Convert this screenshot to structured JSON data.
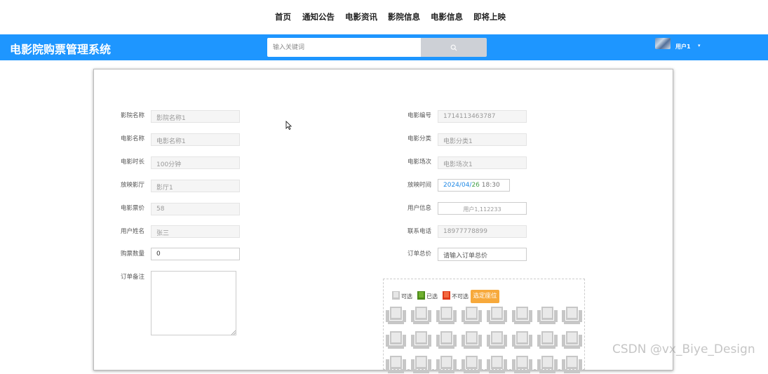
{
  "top_nav": [
    "首页",
    "通知公告",
    "电影资讯",
    "影院信息",
    "电影信息",
    "即将上映"
  ],
  "header": {
    "brand": "电影院购票管理系统",
    "search_placeholder": "输入关键词",
    "username": "用户1",
    "accent_color": "#1e96ff"
  },
  "form": {
    "left": [
      {
        "label": "影院名称",
        "value": "影院名称1"
      },
      {
        "label": "电影名称",
        "value": "电影名称1"
      },
      {
        "label": "电影时长",
        "value": "100分钟"
      },
      {
        "label": "放映影厅",
        "value": "影厅1"
      },
      {
        "label": "电影票价",
        "value": "58"
      },
      {
        "label": "用户姓名",
        "value": "张三"
      },
      {
        "label": "购票数量",
        "value": "0"
      }
    ],
    "right": [
      {
        "label": "电影编号",
        "value": "1714113463787"
      },
      {
        "label": "电影分类",
        "value": "电影分类1"
      },
      {
        "label": "电影场次",
        "value": "电影场次1"
      },
      {
        "label": "放映时间",
        "date_year": "2024",
        "date_month": "04",
        "date_day": "26",
        "time": "18:30"
      },
      {
        "label": "用户信息",
        "value": "用户1,112233"
      },
      {
        "label": "联系电话",
        "value": "18977778899"
      },
      {
        "label": "订单总价",
        "placeholder": "请输入订单总价"
      }
    ],
    "remark_label": "订单备注"
  },
  "seats": {
    "legend_available": "可选",
    "legend_selected": "已选",
    "legend_unavailable": "不可选",
    "pick_button": "选定座位",
    "colors": {
      "available": "#c7c7c7",
      "selected": "#4c8a1a",
      "unavailable": "#e03a1a",
      "button": "#f7a93b"
    }
  },
  "watermark": "CSDN @vx_Biye_Design"
}
